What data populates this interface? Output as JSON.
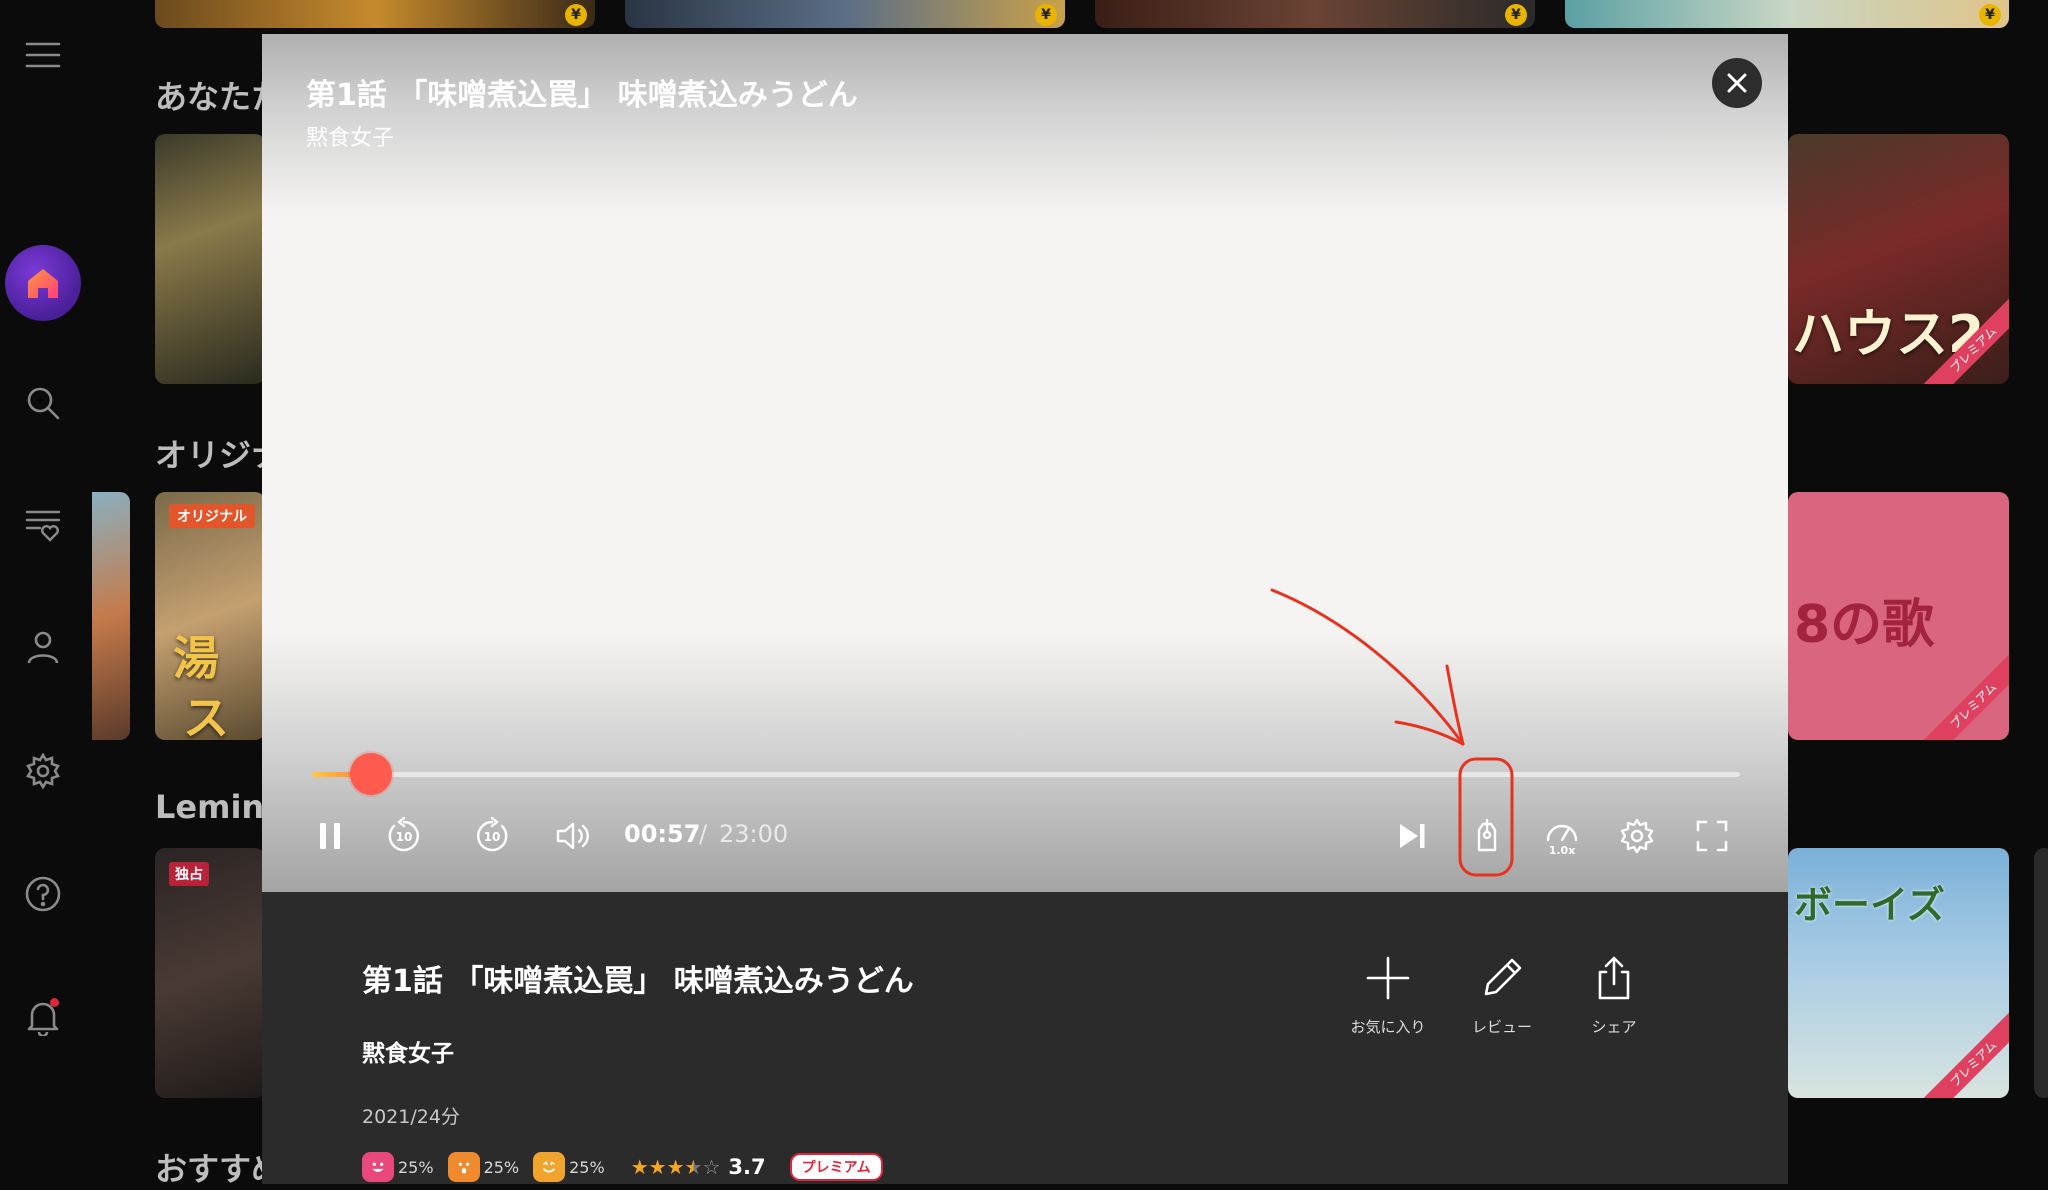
{
  "sidebar": {
    "items": [
      {
        "icon": "menu-icon"
      },
      {
        "icon": "home-icon",
        "active": true
      },
      {
        "icon": "search-icon"
      },
      {
        "icon": "favorite-list-icon"
      },
      {
        "icon": "profile-icon"
      },
      {
        "icon": "settings-icon"
      },
      {
        "icon": "help-icon"
      },
      {
        "icon": "bell-icon",
        "has_badge": true
      }
    ]
  },
  "background": {
    "sections": [
      {
        "title": "あなたた"
      },
      {
        "title": "オリジナ"
      },
      {
        "title": "Lemino"
      },
      {
        "title": "おすすめ"
      }
    ],
    "thumb_labels": {
      "house2": "ハウス2",
      "uta": "8の歌",
      "yu": "湯",
      "su": "ス",
      "boys": "ボーイズ"
    },
    "tags": {
      "original": "オリジナル",
      "exclusive": "独占",
      "premium_ribbon": "プレミアム"
    }
  },
  "player": {
    "title": "第1話 「味噌煮込罠」 味噌煮込みうどん",
    "subtitle": "黙食女子",
    "current_time": "00:57",
    "separator": "/",
    "total_time": "23:00",
    "progress_fraction": 0.0413,
    "speed_label": "1.0x",
    "skip_seconds": "10",
    "annotation_color": "#e8321f"
  },
  "info": {
    "title": "第1話 「味噌煮込罠」 味噌煮込みうどん",
    "series": "黙食女子",
    "meta": "2021/24分",
    "reactions": [
      {
        "icon": "laugh-face-icon",
        "percent": "25%",
        "color": "#e8487c"
      },
      {
        "icon": "surprised-face-icon",
        "percent": "25%",
        "color": "#f08a2e"
      },
      {
        "icon": "excited-face-icon",
        "percent": "25%",
        "color": "#f0a42e"
      }
    ],
    "rating_value": 3.5,
    "rating_text": "3.7",
    "premium_label": "プレミアム",
    "actions": {
      "favorite": "お気に入り",
      "review": "レビュー",
      "share": "シェア"
    }
  }
}
